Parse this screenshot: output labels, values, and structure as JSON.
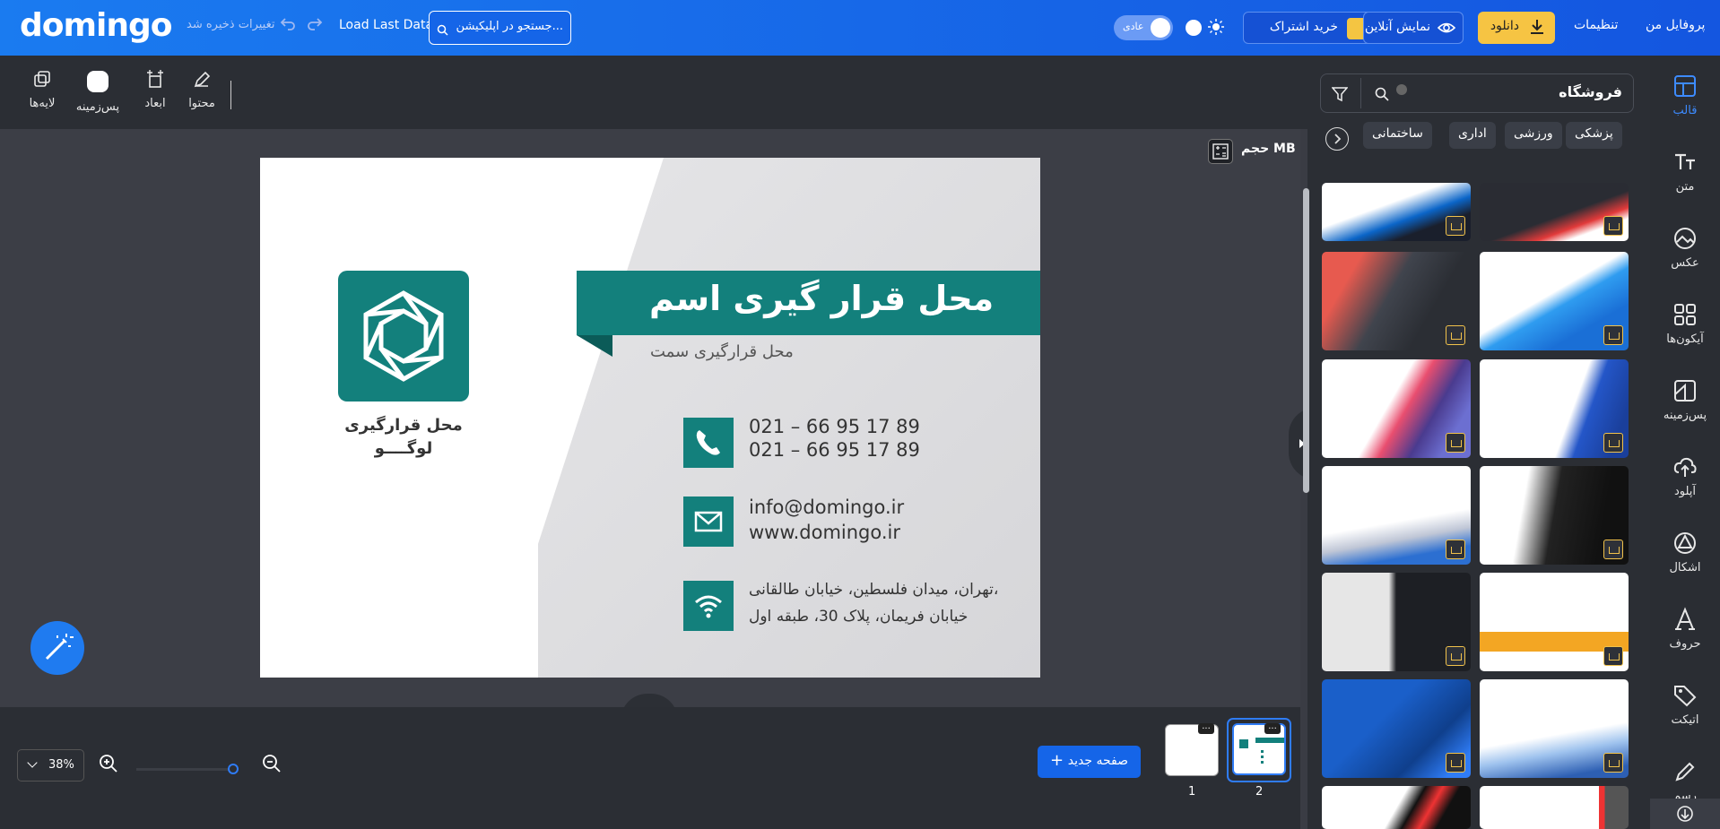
{
  "header": {
    "logo": "domingo",
    "saved_status": "تغییرات ذخیره شد",
    "load_last": "Load Last Data",
    "search_placeholder": "جستجو در اپلیکیشن...",
    "theme_label": "عادی",
    "subscribe": "خرید اشتراک",
    "online_preview": "نمایش آنلاین",
    "download": "دانلود",
    "settings": "تنظیمات",
    "profile": "پروفایل من"
  },
  "sidebar": {
    "items": [
      {
        "label": "قالب",
        "icon": "template-icon"
      },
      {
        "label": "متن",
        "icon": "text-icon"
      },
      {
        "label": "عکس",
        "icon": "image-icon"
      },
      {
        "label": "آیکون‌ها",
        "icon": "grid-icon"
      },
      {
        "label": "پس‌زمینه",
        "icon": "background-icon"
      },
      {
        "label": "آپلود",
        "icon": "upload-icon"
      },
      {
        "label": "اشکال",
        "icon": "shapes-icon"
      },
      {
        "label": "حروف",
        "icon": "letters-icon"
      },
      {
        "label": "اتیکت",
        "icon": "tag-icon"
      },
      {
        "label": "رسم",
        "icon": "pencil-icon"
      }
    ]
  },
  "panel": {
    "search_value": "فروشگاه",
    "chips": [
      "پزشکی",
      "ورزشی",
      "اداری",
      "ساختمانی"
    ]
  },
  "toolbar": {
    "items": [
      "محتوا",
      "ابعاد",
      "پس‌زمینه",
      "لایه‌ها"
    ]
  },
  "size_label": "حجم MB",
  "card": {
    "name": "محل قرار گیری اسم",
    "position": "محل قرارگیری سمت",
    "logo_line1": "محل قرارگیری",
    "logo_line2": "لوگــــو",
    "phone1": "021 – 66 95 17 89",
    "phone2": "021 – 66 95 17 89",
    "email": "info@domingo.ir",
    "website": "www.domingo.ir",
    "address1": "تهران، میدان فلسطین، خیابان طالقانی،",
    "address2": "خیابان فریمان، پلاک 30، طبقه اول"
  },
  "bottom": {
    "zoom": "38%",
    "new_page": "صفحه جدید",
    "pages": [
      "1",
      "2"
    ]
  },
  "colors": {
    "brand": "#1565e8",
    "accent": "#f6c443",
    "teal": "#13807c"
  }
}
